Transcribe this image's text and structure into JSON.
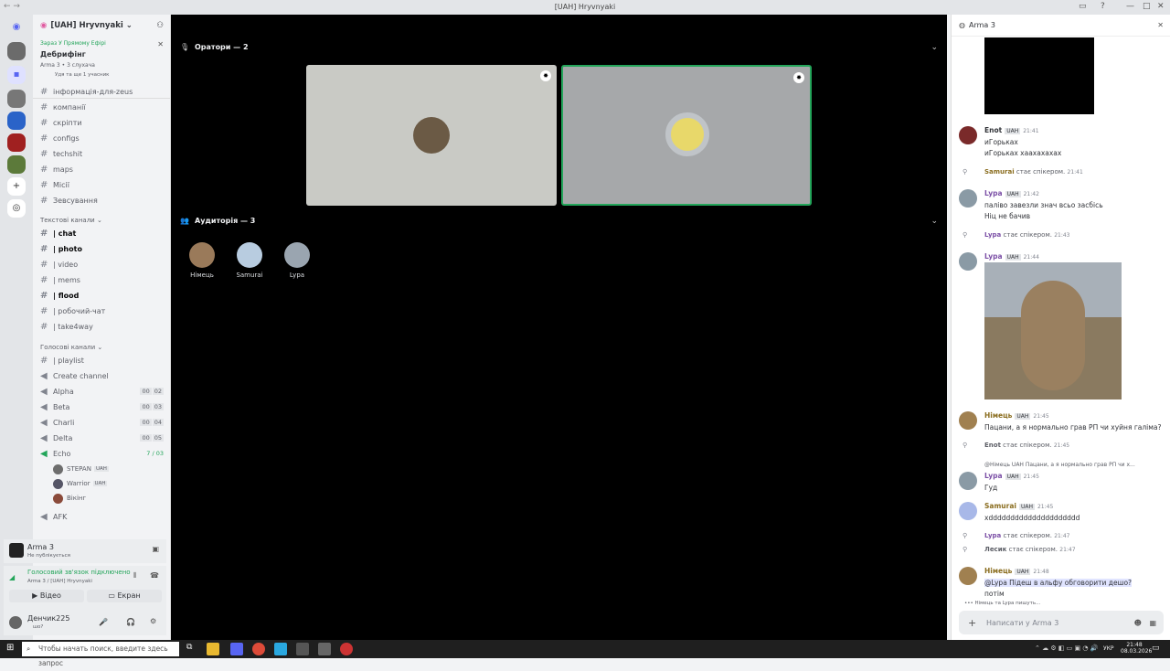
{
  "window": {
    "title": "[UAH] Hryvnyaki"
  },
  "guild": {
    "name": "[UAH] Hryvnyaki"
  },
  "live": {
    "label": "Зараз У Прямому Ефірі",
    "stage_name": "Дебрифінг",
    "meta": "Arma 3 • 3 слухача",
    "extra": "Удя та ще 1 учасник"
  },
  "channels": [
    {
      "name": "інформація-для-zeus",
      "bold": false
    },
    {
      "name": "компанії",
      "bold": false
    },
    {
      "name": "скріпти",
      "bold": false
    },
    {
      "name": "configs",
      "bold": false
    },
    {
      "name": "techshit",
      "bold": false
    },
    {
      "name": "maps",
      "bold": false
    },
    {
      "name": "Місії",
      "bold": false
    },
    {
      "name": "Зевсування",
      "bold": false
    }
  ],
  "text_category": "Текстові канали",
  "text_channels": [
    {
      "name": "| chat",
      "bold": true
    },
    {
      "name": "| photo",
      "bold": true
    },
    {
      "name": "| video",
      "bold": false
    },
    {
      "name": "| mems",
      "bold": false
    },
    {
      "name": "| flood",
      "bold": true
    },
    {
      "name": "| робочий-чат",
      "bold": false
    },
    {
      "name": "| take4way",
      "bold": false
    }
  ],
  "voice_category": "Голосові канали",
  "voice_channels": [
    {
      "name": "| playlist",
      "c1": "",
      "c2": ""
    },
    {
      "name": "Create channel",
      "c1": "",
      "c2": ""
    },
    {
      "name": "Alpha",
      "c1": "00",
      "c2": "02"
    },
    {
      "name": "Beta",
      "c1": "00",
      "c2": "03"
    },
    {
      "name": "Charli",
      "c1": "00",
      "c2": "04"
    },
    {
      "name": "Delta",
      "c1": "00",
      "c2": "05"
    },
    {
      "name": "Echo",
      "c1": "7 / 03",
      "c2": ""
    }
  ],
  "echo_users": [
    {
      "name": "STEPAN",
      "tag": "UAH"
    },
    {
      "name": "Warrior",
      "tag": "UAH"
    },
    {
      "name": "Вікінг",
      "tag": ""
    }
  ],
  "afk": "AFK",
  "activity": {
    "game": "Arma 3",
    "sub": "Не публікується"
  },
  "voice_status": {
    "title": "Голосовий зв'язок підключено",
    "sub": "Arma 3 / [UAH] Hryvnyaki"
  },
  "buttons": {
    "video": "Відео",
    "screen": "Екран"
  },
  "user": {
    "name": "Денчик225",
    "status": "шо?"
  },
  "stage": {
    "speakers_title": "Оратори — 2",
    "audience_title": "Аудиторія — 3",
    "audience": [
      "Німець",
      "Samurai",
      "Lypa"
    ]
  },
  "chat": {
    "title": "Arma 3",
    "placeholder": "Написати у Arma 3",
    "messages": [
      {
        "kind": "msg",
        "name": "Enot",
        "tag": "UAH",
        "time": "21:41",
        "lines": [
          "иГорьках",
          "иГорьках хаахахахах"
        ],
        "color": "#060607"
      },
      {
        "kind": "sys",
        "name": "Samurai",
        "text": "стає спікером.",
        "time": "21:41"
      },
      {
        "kind": "msg",
        "name": "Lypa",
        "tag": "UAH",
        "time": "21:42",
        "lines": [
          "паліво завезли знач всьо засбісь",
          "Ніц не бачив"
        ],
        "color": "#7b4fa6"
      },
      {
        "kind": "sys",
        "name": "Lypa",
        "text": "стає спікером.",
        "time": "21:43"
      },
      {
        "kind": "msg",
        "name": "Lypa",
        "tag": "UAH",
        "time": "21:44",
        "lines": [],
        "color": "#7b4fa6"
      },
      {
        "kind": "msg",
        "name": "Німець",
        "tag": "UAH",
        "time": "21:45",
        "lines": [
          "Пацани, а я нормально грав РП чи хуйня галіма?"
        ],
        "color": "#8a6d1f"
      },
      {
        "kind": "sys",
        "name": "Enot",
        "text": "стає спікером.",
        "time": "21:45"
      },
      {
        "kind": "reply",
        "text": "@Німець UAH Пацани, а я нормально грав РП чи х..."
      },
      {
        "kind": "msg",
        "name": "Lypa",
        "tag": "UAH",
        "time": "21:45",
        "lines": [
          "Гуд"
        ],
        "color": "#7b4fa6"
      },
      {
        "kind": "msg",
        "name": "Samurai",
        "tag": "UAH",
        "time": "21:45",
        "lines": [
          "xddddddddddddddddddddd"
        ],
        "color": "#8a6d1f"
      },
      {
        "kind": "sys",
        "name": "Lypa",
        "text": "стає спікером.",
        "time": "21:47"
      },
      {
        "kind": "sys",
        "name": "Лесик",
        "text": "стає спікером.",
        "time": "21:47"
      },
      {
        "kind": "msg",
        "name": "Німець",
        "tag": "UAH",
        "time": "21:48",
        "lines": [
          "@Lypa Підеш в альфу обговорити дешо?",
          "потім"
        ],
        "color": "#8a6d1f"
      }
    ],
    "typing": "Німець та Lypa пишуть..."
  },
  "taskbar": {
    "search": "Чтобы начать поиск, введите здесь запрос",
    "time": "21:48",
    "date": "08.03.2026",
    "lang": "УКР"
  }
}
